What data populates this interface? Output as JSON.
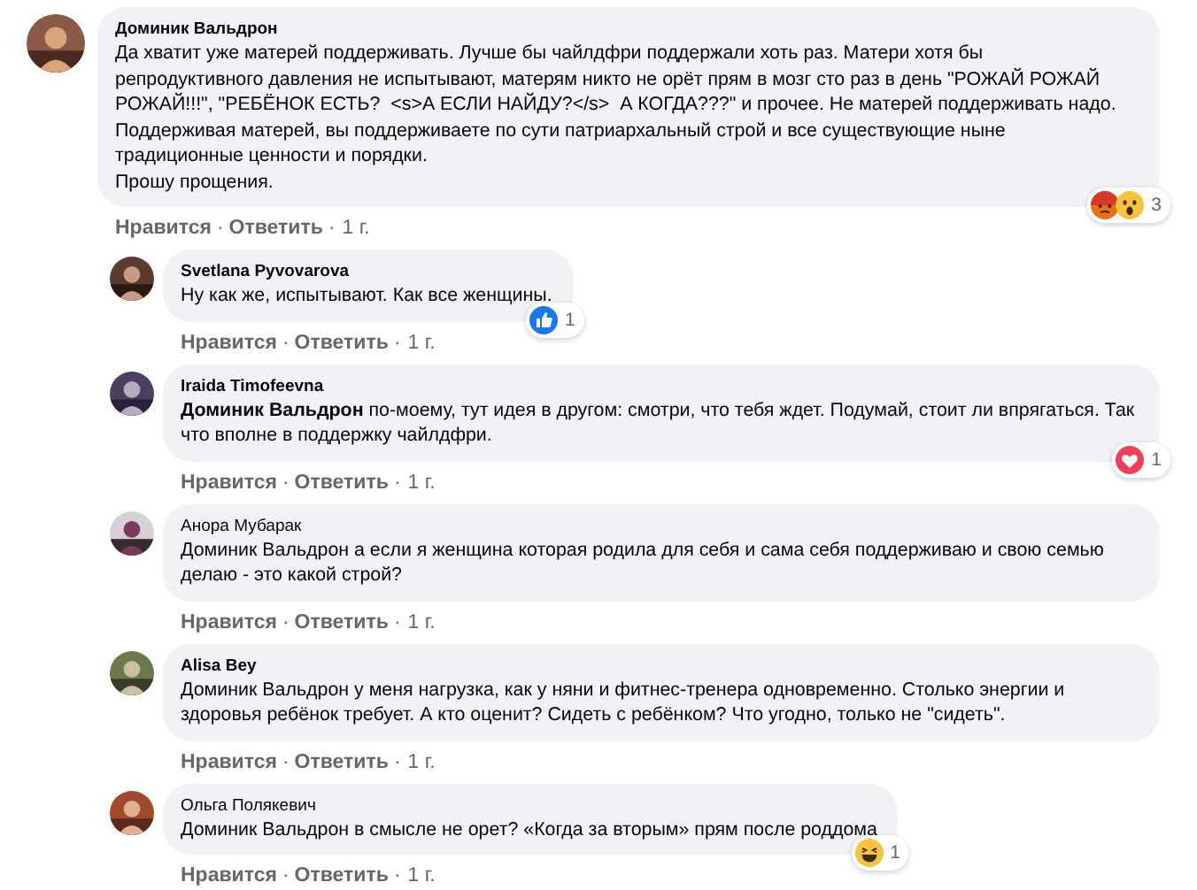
{
  "separator": "·",
  "comments": [
    {
      "author": "Доминик Вальдрон",
      "bold_name": true,
      "reply": false,
      "text": "Да хватит уже матерей поддерживать. Лучше бы чайлдфри поддержали хоть раз. Матери хотя бы репродуктивного давления не испытывают, матерям никто не орёт прям в мозг сто раз в день \"РОЖАЙ РОЖАЙ РОЖАЙ!!!\", \"РЕБЁНОК ЕСТЬ?  <s>А ЕСЛИ НАЙДУ?</s>  А КОГДА???\" и прочее. Не матерей поддерживать надо.\nПоддерживая матерей, вы поддерживаете по сути патриархальный строй и все существующие ныне традиционные ценности и порядки.\nПрошу прощения.",
      "reactions": [
        {
          "kind": "angry"
        },
        {
          "kind": "wow"
        }
      ],
      "reaction_count": "3",
      "like": "Нравится",
      "reply_link": "Ответить",
      "time": "1 г."
    },
    {
      "author": "Svetlana Pyvovarova",
      "bold_name": true,
      "reply": true,
      "text": "Ну как же, испытывают. Как все женщины.",
      "reactions": [
        {
          "kind": "like"
        }
      ],
      "reaction_count": "1",
      "like": "Нравится",
      "reply_link": "Ответить",
      "time": "1 г."
    },
    {
      "author": "Iraida Timofeevna",
      "bold_name": true,
      "reply": true,
      "text": "**Доминик Вальдрон** по-моему, тут идея в другом: смотри, что тебя ждет. Подумай, стоит ли впрягаться. Так что вполне в поддержку чайлдфри.",
      "reactions": [
        {
          "kind": "love"
        }
      ],
      "reaction_count": "1",
      "like": "Нравится",
      "reply_link": "Ответить",
      "time": "1 г."
    },
    {
      "author": "Анора Мубарак",
      "bold_name": false,
      "reply": true,
      "text": "Доминик Вальдрон а если я женщина которая родила для себя и сама себя поддерживаю и свою семью делаю - это какой строй?",
      "like": "Нравится",
      "reply_link": "Ответить",
      "time": "1 г."
    },
    {
      "author": "Alisa Bey",
      "bold_name": true,
      "reply": true,
      "text": "Доминик Вальдрон у меня нагрузка, как у няни и фитнес-тренера одновременно. Столько энергии и здоровья ребёнок требует. А кто оценит? Сидеть с ребёнком? Что угодно, только не \"сидеть\".",
      "like": "Нравится",
      "reply_link": "Ответить",
      "time": "1 г."
    },
    {
      "author": "Ольга Полякевич",
      "bold_name": false,
      "reply": true,
      "text": "Доминик Вальдрон в смысле не орет? «Когда за вторым» прям после роддома",
      "reactions": [
        {
          "kind": "haha"
        }
      ],
      "reaction_count": "1",
      "like": "Нравится",
      "reply_link": "Ответить",
      "time": "1 г."
    }
  ]
}
